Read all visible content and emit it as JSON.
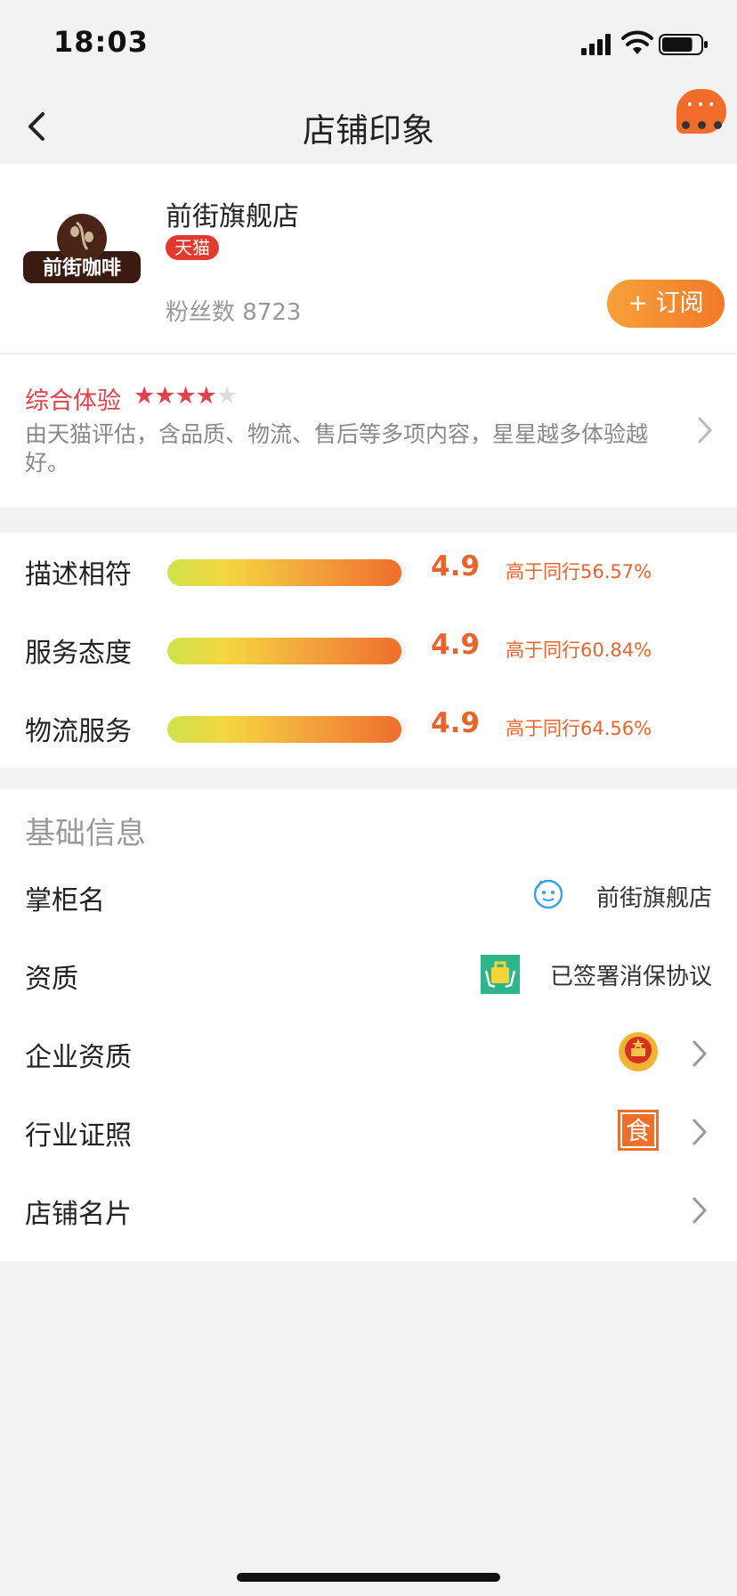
{
  "status_bar": {
    "time": "18:03",
    "battery_level": 0.8
  },
  "nav": {
    "title": "店铺印象",
    "more_label": "···"
  },
  "store": {
    "name": "前街旗舰店",
    "badge": "天猫",
    "logo_text": "前街咖啡",
    "fans_label": "粉丝数",
    "fans_count": "8723",
    "subscribe_label": "+ 订阅"
  },
  "experience": {
    "title": "综合体验",
    "stars_filled": 4,
    "stars_total": 5,
    "description": "由天猫评估，含品质、物流、售后等多项内容，星星越多体验越好。"
  },
  "ratings": [
    {
      "label": "描述相符",
      "score": "4.9",
      "compare": "高于同行56.57%",
      "fill": 0.98
    },
    {
      "label": "服务态度",
      "score": "4.9",
      "compare": "高于同行60.84%",
      "fill": 0.98
    },
    {
      "label": "物流服务",
      "score": "4.9",
      "compare": "高于同行64.56%",
      "fill": 0.98
    }
  ],
  "basic_info": {
    "header": "基础信息",
    "rows": [
      {
        "label": "掌柜名",
        "value": "前街旗舰店",
        "icon": "wangwang-chat-icon"
      },
      {
        "label": "资质",
        "value": "已签署消保协议",
        "icon": "consumer-protection-icon"
      },
      {
        "label": "企业资质",
        "value": "",
        "icon": "national-emblem-icon"
      },
      {
        "label": "行业证照",
        "value": "",
        "icon": "food-license-icon",
        "icon_text": "食"
      },
      {
        "label": "店铺名片",
        "value": "",
        "icon": ""
      }
    ]
  },
  "colors": {
    "accent_orange": "#e8642c",
    "tmall_red": "#e23a2e",
    "star_red": "#e0414a",
    "background": "#f2f2f2"
  }
}
